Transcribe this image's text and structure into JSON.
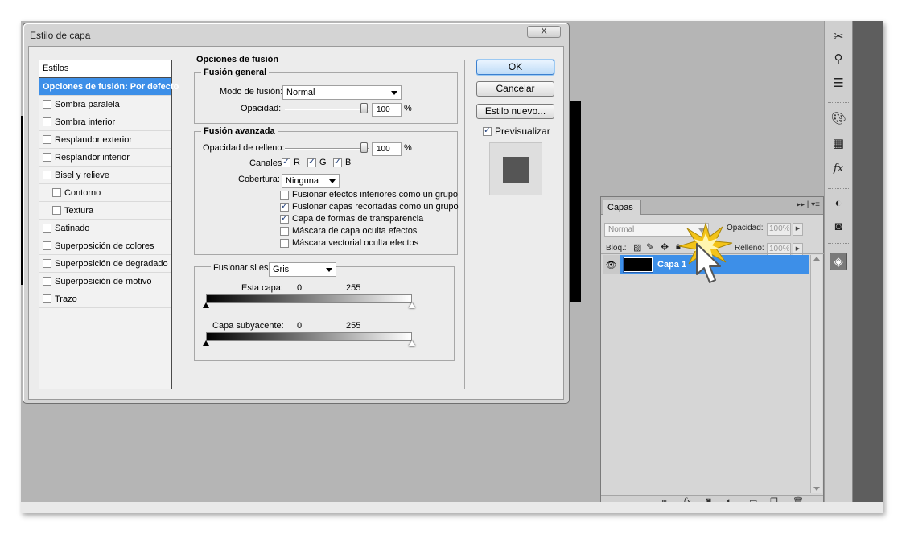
{
  "dialog": {
    "title": "Estilo de capa",
    "close_label": "X",
    "styles_header": "Estilos",
    "styles": [
      {
        "label": "Opciones de fusión: Por defecto",
        "active": true,
        "checkbox": false
      },
      {
        "label": "Sombra paralela",
        "checked": false,
        "checkbox": true
      },
      {
        "label": "Sombra interior",
        "checked": false,
        "checkbox": true
      },
      {
        "label": "Resplandor exterior",
        "checked": false,
        "checkbox": true
      },
      {
        "label": "Resplandor interior",
        "checked": false,
        "checkbox": true
      },
      {
        "label": "Bisel y relieve",
        "checked": false,
        "checkbox": true
      },
      {
        "label": "Contorno",
        "checked": false,
        "checkbox": true,
        "indent": true
      },
      {
        "label": "Textura",
        "checked": false,
        "checkbox": true,
        "indent": true
      },
      {
        "label": "Satinado",
        "checked": false,
        "checkbox": true
      },
      {
        "label": "Superposición de colores",
        "checked": false,
        "checkbox": true
      },
      {
        "label": "Superposición de degradado",
        "checked": false,
        "checkbox": true
      },
      {
        "label": "Superposición de motivo",
        "checked": false,
        "checkbox": true
      },
      {
        "label": "Trazo",
        "checked": false,
        "checkbox": true
      }
    ],
    "blend_options": {
      "section_title": "Opciones de fusión",
      "general": {
        "title": "Fusión general",
        "mode_label": "Modo de fusión:",
        "mode_value": "Normal",
        "opacity_label": "Opacidad:",
        "opacity_value": "100",
        "opacity_unit": "%",
        "opacity_level": 1.0
      },
      "advanced": {
        "title": "Fusión avanzada",
        "fill_label": "Opacidad de relleno:",
        "fill_value": "100",
        "fill_unit": "%",
        "fill_level": 1.0,
        "channels_label": "Canales:",
        "channels": [
          {
            "label": "R",
            "checked": true
          },
          {
            "label": "G",
            "checked": true
          },
          {
            "label": "B",
            "checked": true
          }
        ],
        "knockout_label": "Cobertura:",
        "knockout_value": "Ninguna",
        "options": [
          {
            "label": "Fusionar efectos interiores como un grupo",
            "checked": false
          },
          {
            "label": "Fusionar capas recortadas como un grupo",
            "checked": true
          },
          {
            "label": "Capa de formas de transparencia",
            "checked": true
          },
          {
            "label": "Máscara de capa oculta efectos",
            "checked": false
          },
          {
            "label": "Máscara vectorial oculta efectos",
            "checked": false
          }
        ]
      },
      "blend_if": {
        "label": "Fusionar si es:",
        "value": "Gris",
        "this_layer_label": "Esta capa:",
        "this_layer_min": "0",
        "this_layer_max": "255",
        "underlying_label": "Capa subyacente:",
        "underlying_min": "0",
        "underlying_max": "255"
      }
    },
    "buttons": {
      "ok": "OK",
      "cancel": "Cancelar",
      "new_style": "Estilo nuevo...",
      "preview": "Previsualizar",
      "preview_checked": true
    }
  },
  "layers": {
    "tab": "Capas",
    "menu_icons": "▸▸ | ▾≡",
    "mode": "Normal",
    "opacity_label": "Opacidad:",
    "opacity_value": "100%",
    "lock_label": "Bloq.:",
    "fill_label": "Relleno:",
    "fill_value": "100%",
    "layer_name": "Capa 1"
  },
  "colors": {
    "selection_blue": "#3d8fe8",
    "workspace_gray": "#b5b5b5",
    "dark_panel": "#5e5e5e"
  }
}
